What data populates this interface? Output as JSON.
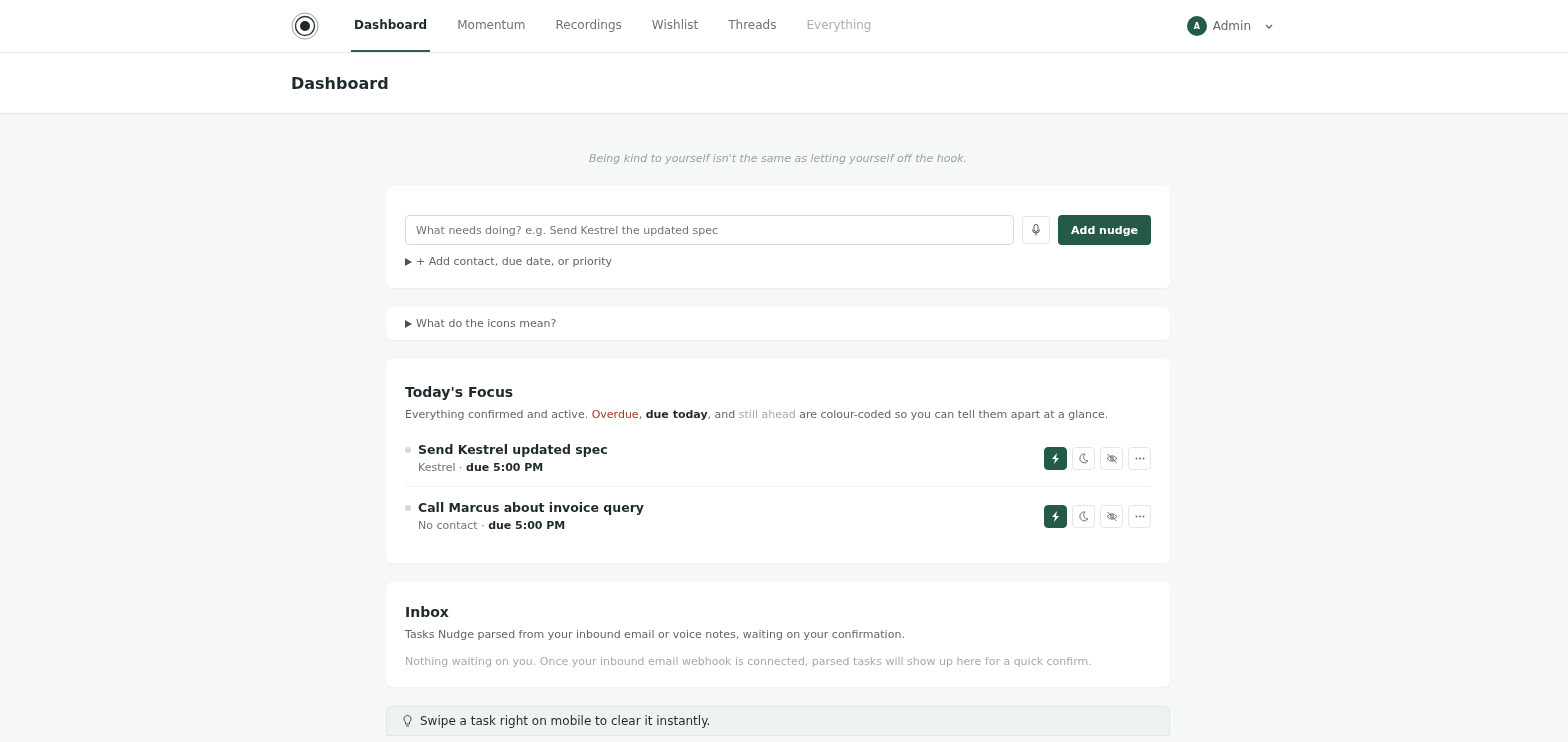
{
  "nav": {
    "tabs": [
      {
        "label": "Dashboard",
        "selected": true,
        "disabled": false
      },
      {
        "label": "Momentum",
        "selected": false,
        "disabled": false
      },
      {
        "label": "Recordings",
        "selected": false,
        "disabled": false
      },
      {
        "label": "Wishlist",
        "selected": false,
        "disabled": false
      },
      {
        "label": "Threads",
        "selected": false,
        "disabled": false
      },
      {
        "label": "Everything",
        "selected": false,
        "disabled": true
      }
    ],
    "user": {
      "initial": "A",
      "name": "Admin"
    }
  },
  "page_title": "Dashboard",
  "quote": "Being kind to yourself isn't the same as letting yourself off the hook.",
  "composer": {
    "placeholder": "What needs doing? e.g. Send Kestrel the updated spec",
    "button": "Add nudge",
    "details_toggle": "+ Add contact, due date, or priority"
  },
  "legend_toggle": "What do the icons mean?",
  "focus": {
    "title": "Today's Focus",
    "description": [
      {
        "kind": "plain",
        "text": "Everything confirmed and active. "
      },
      {
        "kind": "overdue",
        "text": "Overdue"
      },
      {
        "kind": "plain",
        "text": ", "
      },
      {
        "kind": "today",
        "text": "due today"
      },
      {
        "kind": "plain",
        "text": ", and "
      },
      {
        "kind": "ahead",
        "text": "still ahead"
      },
      {
        "kind": "plain",
        "text": " are colour-coded so you can tell them apart at a glance."
      }
    ],
    "tasks": [
      {
        "title": "Send Kestrel updated spec",
        "contact": "Kestrel",
        "separator": "·",
        "due": "due 5:00 PM",
        "actions": [
          {
            "kind": "bolt",
            "selected": true
          },
          {
            "kind": "moon",
            "selected": false
          },
          {
            "kind": "hide",
            "selected": false
          },
          {
            "kind": "more",
            "selected": false
          }
        ]
      },
      {
        "title": "Call Marcus about invoice query",
        "contact": "No contact",
        "separator": "·",
        "due": "due 5:00 PM",
        "actions": [
          {
            "kind": "bolt",
            "selected": true
          },
          {
            "kind": "moon",
            "selected": false
          },
          {
            "kind": "hide",
            "selected": false
          },
          {
            "kind": "more",
            "selected": false
          }
        ]
      }
    ]
  },
  "inbox": {
    "title": "Inbox",
    "description": "Tasks Nudge parsed from your inbound email or voice notes, waiting on your confirmation.",
    "empty": "Nothing waiting on you. Once your inbound email webhook is connected, parsed tasks will show up here for a quick confirm."
  },
  "tip": "Swipe a task right on mobile to clear it instantly."
}
